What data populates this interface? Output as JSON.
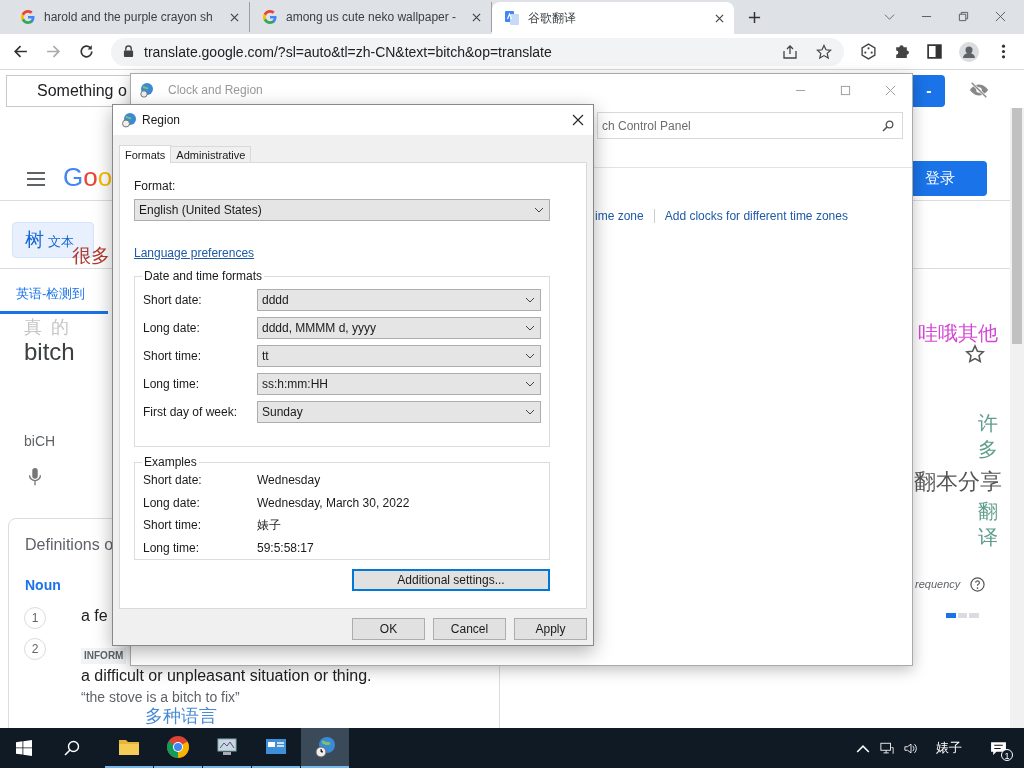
{
  "browser": {
    "tabs": [
      {
        "title": "harold and the purple crayon sh",
        "selected": false
      },
      {
        "title": "among us cute neko wallpaper -",
        "selected": false
      },
      {
        "title": "谷歌翻译",
        "selected": true
      }
    ],
    "url": "translate.google.com/?sl=auto&tl=zh-CN&text=bitch&op=translate"
  },
  "page": {
    "search": {
      "value": "Something o"
    },
    "action_button": "-",
    "logo": "Goo",
    "input_tab": {
      "glyph": "树",
      "label": "文本"
    },
    "red_text": "很多",
    "language_tab": {
      "label": "英语-检测到",
      "selected": true
    },
    "faded_text": "真 的",
    "source_text": "bitch",
    "transliteration": "biCH",
    "definitions": {
      "heading": "Definitions o",
      "part_of_speech": "Noun",
      "entries": [
        {
          "number": "1",
          "text": "a fe"
        },
        {
          "number": "2",
          "tag": "INFORM",
          "text": "a difficult or unpleasant situation or thing.",
          "example": "“the stove is a bitch to fix”"
        }
      ]
    },
    "blue_text": "多种语言",
    "sign_in": "登录",
    "magenta_text": "哇哦其他",
    "vertical_top": "许多",
    "gray_text": "翻本分享",
    "vertical_bottom": "翻译",
    "frequency": {
      "label": "requency"
    }
  },
  "clock_window": {
    "title": "Clock and Region",
    "search": {
      "placeholder": "ch Control Panel"
    },
    "links": [
      "ime zone",
      "Add clocks for different time zones"
    ]
  },
  "region_dialog": {
    "title": "Region",
    "tabs": [
      {
        "label": "Formats",
        "selected": true
      },
      {
        "label": "Administrative",
        "selected": false
      }
    ],
    "format": {
      "label": "Format:",
      "value": "English (United States)"
    },
    "link": "Language preferences",
    "formats": {
      "title": "Date and time formats",
      "rows": [
        {
          "label": "Short date:",
          "value": "dddd"
        },
        {
          "label": "Long date:",
          "value": "dddd, MMMM d, yyyy"
        },
        {
          "label": "Short time:",
          "value": "tt"
        },
        {
          "label": "Long time:",
          "value": "ss:h:mm:HH"
        },
        {
          "label": "First day of week:",
          "value": "Sunday"
        }
      ]
    },
    "examples": {
      "title": "Examples",
      "rows": [
        {
          "label": "Short date:",
          "value": "Wednesday"
        },
        {
          "label": "Long date:",
          "value": "Wednesday, March 30, 2022"
        },
        {
          "label": "Short time:",
          "value": "婊子"
        },
        {
          "label": "Long time:",
          "value": "59:5:58:17"
        }
      ]
    },
    "additional_button": {
      "label": "Additional settings...",
      "focused": true
    },
    "buttons": [
      "OK",
      "Cancel",
      "Apply"
    ]
  },
  "taskbar": {
    "apps": [
      {
        "kind": "folder",
        "selected": false
      },
      {
        "kind": "chrome",
        "selected": false
      },
      {
        "kind": "monitor",
        "selected": false
      },
      {
        "kind": "screen",
        "selected": false
      },
      {
        "kind": "globe",
        "selected": true
      }
    ],
    "tray_text": "婊子",
    "notifications": "1"
  }
}
